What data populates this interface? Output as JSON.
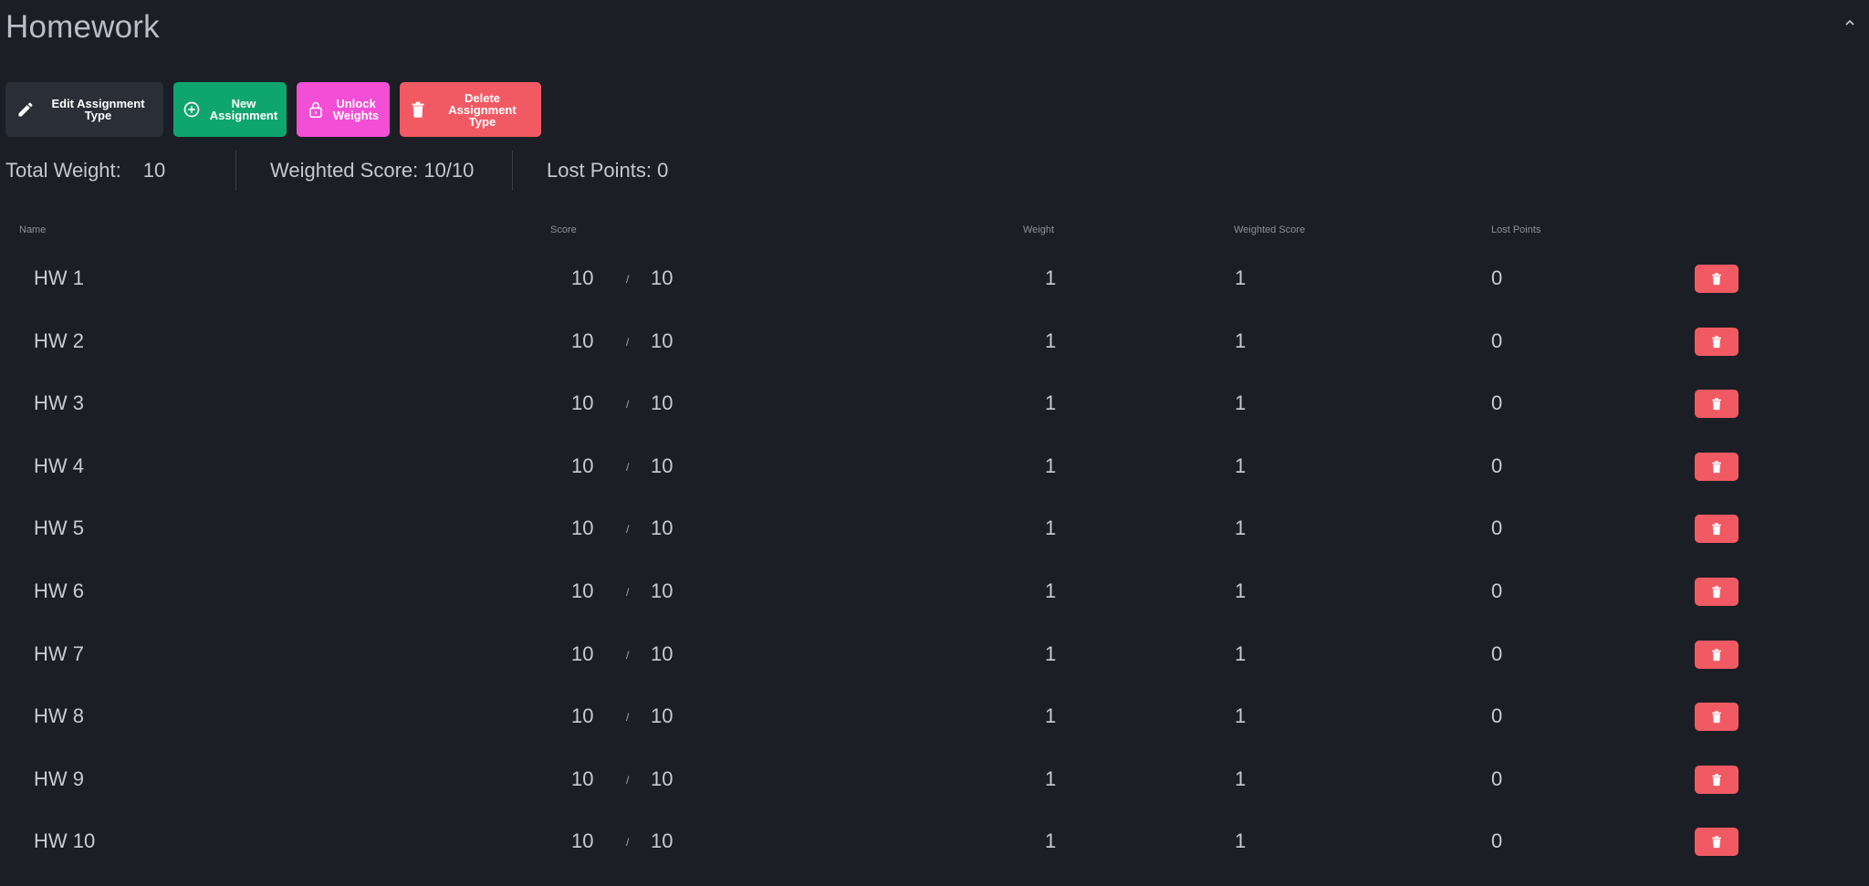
{
  "section": {
    "title": "Homework"
  },
  "toolbar": {
    "edit_label": "Edit Assignment Type",
    "new_label": "New\nAssignment",
    "unlock_label": "Unlock\nWeights",
    "delete_label": "Delete\nAssignment Type",
    "colors": {
      "edit": "#2a2e36",
      "new": "#0fa56f",
      "unlock": "#f24fd6",
      "delete": "#f15a63"
    }
  },
  "stats": {
    "total_weight_label": "Total Weight:",
    "total_weight_value": "10",
    "weighted_score": "Weighted Score: 10/10",
    "lost_points": "Lost Points: 0"
  },
  "table": {
    "headers": {
      "name": "Name",
      "score": "Score",
      "weight": "Weight",
      "weighted_score": "Weighted Score",
      "lost_points": "Lost Points"
    },
    "rows": [
      {
        "name": "HW 1",
        "score": "10",
        "sep": "/",
        "max": "10",
        "weight": "1",
        "weighted": "1",
        "lost": "0"
      },
      {
        "name": "HW 2",
        "score": "10",
        "sep": "/",
        "max": "10",
        "weight": "1",
        "weighted": "1",
        "lost": "0"
      },
      {
        "name": "HW 3",
        "score": "10",
        "sep": "/",
        "max": "10",
        "weight": "1",
        "weighted": "1",
        "lost": "0"
      },
      {
        "name": "HW 4",
        "score": "10",
        "sep": "/",
        "max": "10",
        "weight": "1",
        "weighted": "1",
        "lost": "0"
      },
      {
        "name": "HW 5",
        "score": "10",
        "sep": "/",
        "max": "10",
        "weight": "1",
        "weighted": "1",
        "lost": "0"
      },
      {
        "name": "HW 6",
        "score": "10",
        "sep": "/",
        "max": "10",
        "weight": "1",
        "weighted": "1",
        "lost": "0"
      },
      {
        "name": "HW 7",
        "score": "10",
        "sep": "/",
        "max": "10",
        "weight": "1",
        "weighted": "1",
        "lost": "0"
      },
      {
        "name": "HW 8",
        "score": "10",
        "sep": "/",
        "max": "10",
        "weight": "1",
        "weighted": "1",
        "lost": "0"
      },
      {
        "name": "HW 9",
        "score": "10",
        "sep": "/",
        "max": "10",
        "weight": "1",
        "weighted": "1",
        "lost": "0"
      },
      {
        "name": "HW 10",
        "score": "10",
        "sep": "/",
        "max": "10",
        "weight": "1",
        "weighted": "1",
        "lost": "0"
      }
    ],
    "row_delete_icon": "trash-icon",
    "row_delete_color": "#f15a63"
  },
  "icons": {
    "edit": "pencil-icon",
    "new": "plus-circle-icon",
    "unlock": "lock-open-icon",
    "delete": "trash-icon",
    "collapse": "chevron-up-icon"
  },
  "colors": {
    "background": "#1b1e24",
    "text": "#c9ccd2"
  }
}
